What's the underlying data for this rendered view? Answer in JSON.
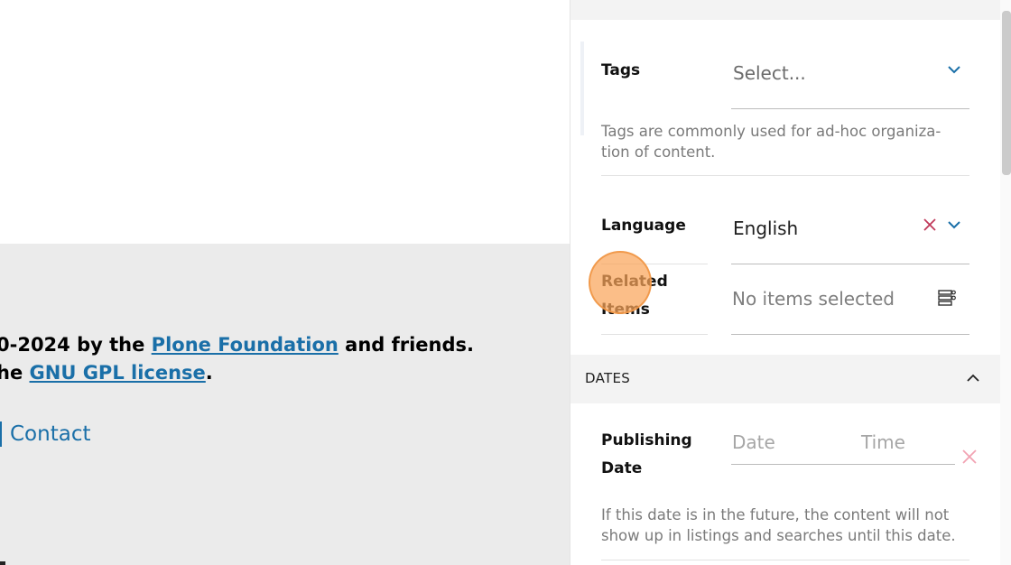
{
  "footer": {
    "line1_prefix": "0-2024 by the ",
    "line1_link": "Plone Foundation",
    "line1_suffix": " and friends.",
    "line2_prefix": "he ",
    "line2_link": "GNU GPL license",
    "line2_suffix": ".",
    "contact_link": "Contact"
  },
  "sidebar": {
    "tags": {
      "label": "Tags",
      "placeholder": "Select...",
      "help": "Tags are commonly used for ad-hoc organiza- tion of content."
    },
    "language": {
      "label": "Language",
      "value": "English"
    },
    "related_items": {
      "label_line1": "Related",
      "label_line2": "Items",
      "value": "No items selected"
    },
    "dates_section": {
      "title": "DATES"
    },
    "publishing_date": {
      "label_line1": "Publishing",
      "label_line2": "Date",
      "date_placeholder": "Date",
      "time_placeholder": "Time",
      "help": "If this date is in the future, the content will not show up in listings and searches until this date."
    }
  },
  "colors": {
    "link": "#1a6fa8",
    "chevron": "#1a6fa8",
    "clear_x": "#c0395a",
    "clear_x_light": "#f2a3b3",
    "click_marker": "#f5a55c"
  },
  "icons": {
    "tags_dropdown": "chevron-down-icon",
    "language_dropdown": "chevron-down-icon",
    "language_clear": "close-icon",
    "related_browse": "object-browser-icon",
    "dates_collapse": "chevron-up-icon",
    "date_clear": "close-icon"
  }
}
